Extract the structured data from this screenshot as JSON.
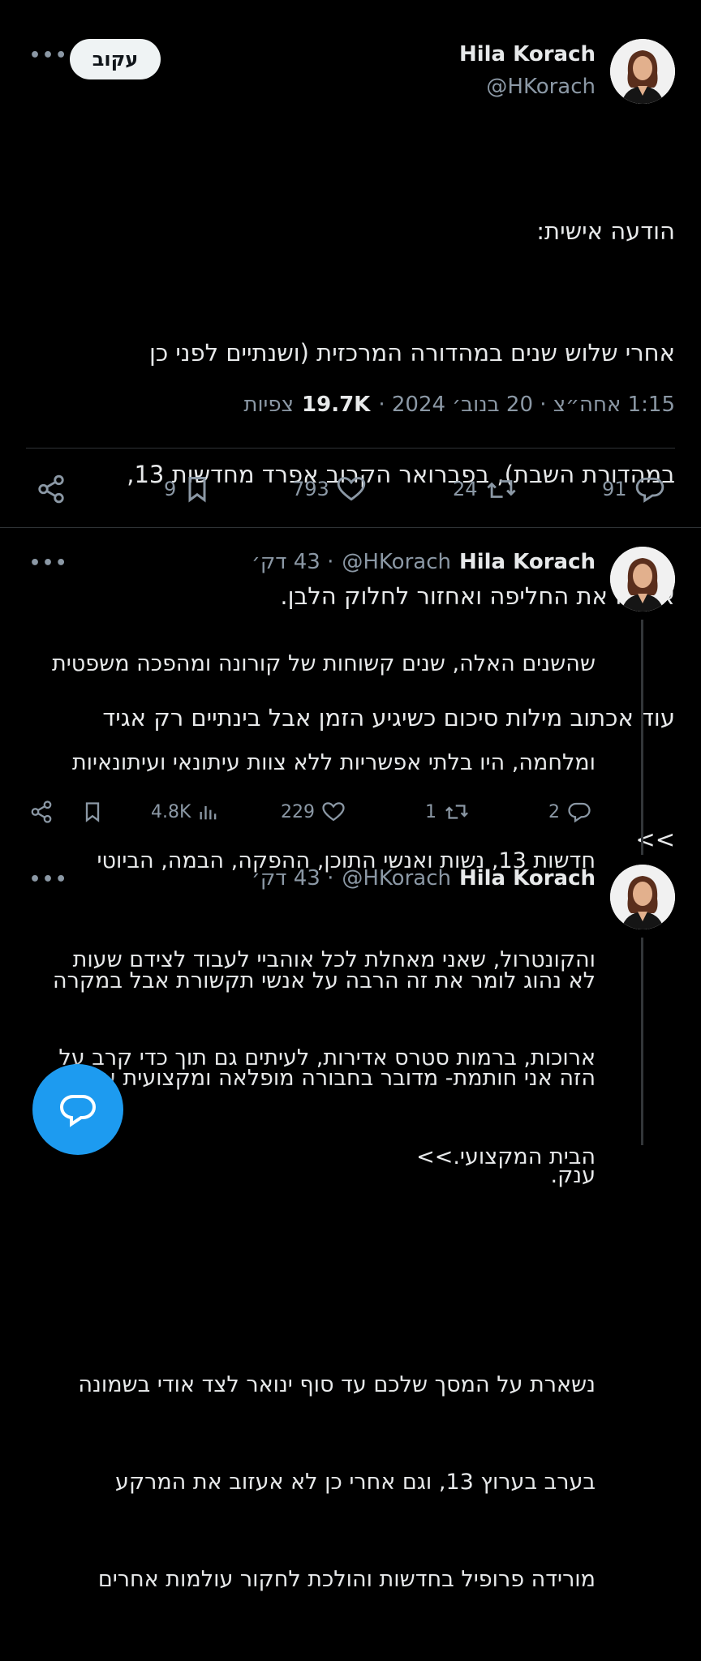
{
  "main_tweet": {
    "name": "Hila Korach",
    "handle": "@HKorach",
    "follow_label": "עקוב",
    "more_label": "•••",
    "text_lines": [
      "הודעה אישית:",
      "אחרי שלוש שנים במהדורה המרכזית (ושנתיים לפני כן",
      "במהדורת השבת), בפברואר הקרוב אפרד מחדשות 13,",
      "אתלה את החליפה ואחזור לחלוק הלבן.",
      "עוד אכתוב מילות סיכום כשיגיע הזמן אבל בינתיים רק אגיד",
      ">>"
    ],
    "meta_time_date": "1:15 אחה״צ · 20 בנוב׳ 2024 ·",
    "views_count": "19.7K",
    "views_label": "צפיות",
    "actions": {
      "replies": "91",
      "retweets": "24",
      "likes": "793",
      "bookmarks": "9"
    }
  },
  "replies": [
    {
      "name": "Hila Korach",
      "handle": "@HKorach",
      "time": "· 43 דק׳",
      "more_label": "•••",
      "text_lines": [
        "שהשנים האלה, שנים קשוחות של קורונה ומהפכה משפטית",
        "ומלחמה, היו בלתי אפשריות ללא צוות עיתונאי ועיתונאיות",
        "חדשות 13, נשות ואנשי התוכן, ההפקה, הבמה, הביוטי",
        "והקונטרול, שאני מאחלת לכל אוהביי לעבוד לצידם שעות",
        "ארוכות, ברמות סטרס אדירות, לעיתים גם תוך כדי קרב על",
        "הבית המקצועי.>>"
      ],
      "actions": {
        "replies": "2",
        "retweets": "1",
        "likes": "229",
        "views": "4.8K"
      }
    },
    {
      "name": "Hila Korach",
      "handle": "@HKorach",
      "time": "· 43 דק׳",
      "more_label": "•••",
      "text_lines": [
        "לא נהוג לומר את זה הרבה על אנשי תקשורת אבל במקרה",
        "הזה אני חותמת- מדובר בחבורה מופלאה ומקצועית עם לב",
        "ענק.",
        "",
        "נשארת על המסך שלכם עד סוף ינואר לצד אודי בשמונה",
        "בערב בערוץ 13, וגם אחרי כן לא אעזוב את המרקע",
        "מורידה פרופיל בחדשות והולכת לחקור עולמות אחרים"
      ]
    }
  ],
  "colors": {
    "background": "#000000",
    "text": "#e7e9ea",
    "muted": "#8b98a5",
    "divider": "#2f3336",
    "accent": "#1d9bf0"
  },
  "icons": [
    "avatar-photo",
    "more-icon",
    "reply-icon",
    "retweet-icon",
    "like-icon",
    "bookmark-icon",
    "share-icon",
    "views-icon",
    "compose-reply-icon"
  ]
}
